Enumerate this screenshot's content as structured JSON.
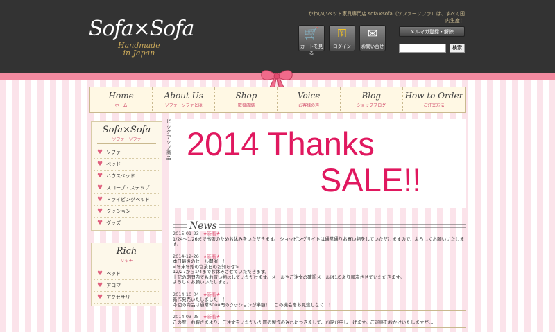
{
  "header": {
    "logo": "Sofa×Sofa",
    "logo_sub_line1": "Handmade",
    "logo_sub_line2": "in Japan",
    "tagline": "かわいいペット家具専門店 sofa×sofa（ソファーソファ）は、すべて国内生産！",
    "buttons": [
      {
        "label": "カートを見る",
        "icon": "cart-icon"
      },
      {
        "label": "ログイン",
        "icon": "key-icon"
      },
      {
        "label": "お問い合せ",
        "icon": "mail-icon"
      }
    ],
    "mailmag_label": "メルマガ登録・解除",
    "search_placeholder": "",
    "search_button": "検索"
  },
  "nav": [
    {
      "main": "Home",
      "sub": "ホーム"
    },
    {
      "main": "About Us",
      "sub": "ソファーソファとは"
    },
    {
      "main": "Shop",
      "sub": "取扱店舗"
    },
    {
      "main": "Voice",
      "sub": "お客様の声"
    },
    {
      "main": "Blog",
      "sub": "ショップブログ"
    },
    {
      "main": "How to Order",
      "sub": "ご注文方法"
    }
  ],
  "sidebar": {
    "section1": {
      "title": "Sofa×Sofa",
      "sub": "ソファーソファ",
      "items": [
        "ソファ",
        "ベッド",
        "ハウスベッド",
        "スロープ・ステップ",
        "ドライビングベッド",
        "クッション",
        "グッズ"
      ]
    },
    "section2": {
      "title": "Rich",
      "sub": "リッチ",
      "items": [
        "ベッド",
        "アロマ",
        "アクセサリー"
      ]
    }
  },
  "pickup_label": "ピックアップ商品",
  "banner": {
    "line1": "2014 Thanks",
    "line2": "SALE!!"
  },
  "news": {
    "title": "News",
    "new_mark": "★新着★",
    "entries": [
      {
        "date": "2015-01-23",
        "lines": [
          "1/24～1/26まで出張のためお休みをいただきます。 ショッピングサイトは通常通りお買い物をしていただけますので、よろしくお願いいたしま",
          "す。"
        ]
      },
      {
        "date": "2014-12-26",
        "lines": [
          "本日最後のセール開催！！",
          "<年末年始の営業日のお知らせ>",
          "12/27から1/4までお休みさせていただきます。",
          "上記の期間内でもお買い物はしていただけます。メールやご注文の確認メールは1/5より順次させていただきます。",
          "よろしくお願いいたします。"
        ]
      },
      {
        "date": "2014-10-04",
        "lines": [
          "新作発売いたしました！！",
          "今回の商品は通常5000円のクッションが半額！！この機会をお見逃しなく！！"
        ]
      },
      {
        "date": "2014-03-25",
        "lines": [
          "この度、お客さまより、ご注文をいただいた際の製作の遅れにつきまして、お詫び申し上げます。ご迷惑をおかけいたしますが…"
        ]
      }
    ]
  },
  "colors": {
    "header_bg": "#333333",
    "accent_pink": "#e0185f",
    "stripe_pink": "#fbe3ea",
    "gold": "#c9b98f"
  }
}
